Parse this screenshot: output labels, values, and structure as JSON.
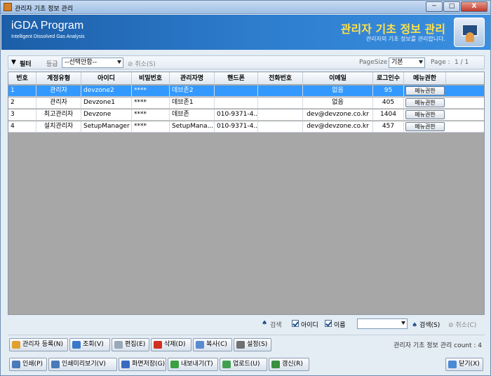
{
  "window": {
    "title": "관리자 기초 정보 관리",
    "min": "─",
    "max": "□",
    "close": "X"
  },
  "banner": {
    "brand": "iGDA Program",
    "sub": "Intelligent Dissolved Gas Analysis",
    "title": "관리자 기초 정보 관리",
    "subtitle": "관리자의 기초 정보를 관리합니다."
  },
  "filter": {
    "label": "필터",
    "grade_label": "등급",
    "grade_value": "--선택안함--",
    "cancel": "취소(S)",
    "pagesize_label": "PageSize",
    "pagesize_value": "기본",
    "page_label": "Page :",
    "page_value": "1 / 1"
  },
  "table": {
    "headers": [
      "번호",
      "계정유형",
      "아이디",
      "비밀번호",
      "관리자명",
      "핸드폰",
      "전화번호",
      "이메일",
      "로그인수",
      "메뉴권한"
    ],
    "rows": [
      [
        "1",
        "관리자",
        "devzone2",
        "****",
        "데브존2",
        "",
        "",
        "없음",
        "95",
        "메뉴권한"
      ],
      [
        "2",
        "관리자",
        "Devzone1",
        "****",
        "데브존1",
        "",
        "",
        "없음",
        "405",
        "메뉴권한"
      ],
      [
        "3",
        "최고관리자",
        "Devzone",
        "****",
        "데브존",
        "010-9371-4...",
        "",
        "dev@devzone.co.kr",
        "1404",
        "메뉴권한"
      ],
      [
        "4",
        "설치관리자",
        "SetupManager",
        "****",
        "SetupMana...",
        "010-9371-4...",
        "",
        "dev@devzone.co.kr",
        "457",
        "메뉴권한"
      ]
    ]
  },
  "search": {
    "label": "검색",
    "chk_id": "아이디",
    "chk_name": "이름",
    "search_btn": "검색(S)",
    "cancel_btn": "취소(C)"
  },
  "toolbar1": [
    "관리자 등록(N)",
    "조회(V)",
    "편집(E)",
    "삭제(D)",
    "복사(C)",
    "설정(S)"
  ],
  "toolbar2": [
    "인쇄(P)",
    "인쇄미리보기(V)",
    "화면저장(G)",
    "내보내기(T)",
    "업로드(U)",
    "갱신(R)"
  ],
  "close_btn": "닫기(X)",
  "status": "관리자 기초 정보 관리 count : 4",
  "colors": {
    "banner": "#2e7ecf",
    "accent": "#ffe14a",
    "selected": "#3399ff"
  }
}
